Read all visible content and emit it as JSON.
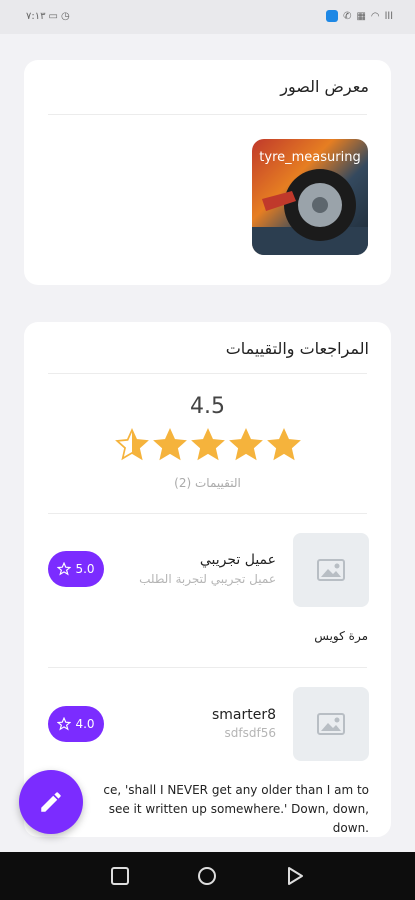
{
  "status_bar": {
    "time": "٧:١٣",
    "signal": "ااا"
  },
  "gallery": {
    "title": "معرض الصور",
    "items": [
      {
        "label": "tyre_measuring"
      }
    ]
  },
  "reviews": {
    "title": "المراجعات والتقييمات",
    "average": "4.5",
    "stars": 4.5,
    "count_label": "التقييمات (2)",
    "list": [
      {
        "name": "عميل تجريبي",
        "subtitle": "عميل تجريبي لتجربة الطلب",
        "rating": "5.0",
        "comment": "مرة كويس"
      },
      {
        "name": "smarter8",
        "subtitle": "sdfsdf56",
        "rating": "4.0",
        "comment": "ce, 'shall I NEVER get any older than I am to see it written up somewhere.' Down, down, down."
      }
    ]
  },
  "colors": {
    "accent": "#7b2cff",
    "star": "#f5b33c"
  },
  "icons": {
    "fab": "pencil-icon",
    "review_placeholder": "image-icon",
    "badge": "star-outline-icon"
  }
}
